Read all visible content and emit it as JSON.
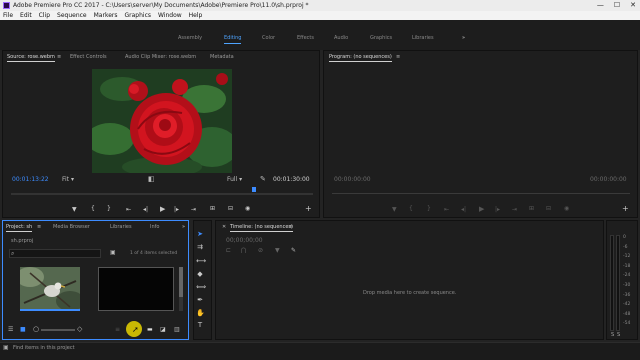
{
  "window": {
    "title": "Adobe Premiere Pro CC 2017 - C:\\Users\\server\\My Documents\\Adobe\\Premiere Pro\\11.0\\sh.prproj *",
    "minimize": "—",
    "maximize": "☐",
    "close": "✕"
  },
  "menu": [
    "File",
    "Edit",
    "Clip",
    "Sequence",
    "Markers",
    "Graphics",
    "Window",
    "Help"
  ],
  "workspaces": [
    "Assembly",
    "Editing",
    "Color",
    "Effects",
    "Audio",
    "Graphics",
    "Libraries"
  ],
  "workspace_more": "»",
  "source": {
    "tabs": [
      "Source: rose.webm",
      "Effect Controls",
      "Audio Clip Mixer: rose.webm",
      "Metadata"
    ],
    "timecode_in": "00:01:13:22",
    "fit": "Fit",
    "quality": "Full",
    "duration": "00:01:30:00",
    "playhead_fraction": 0.81
  },
  "program": {
    "tab": "Program: (no sequences)",
    "tc_left": "00:00:00:00",
    "tc_right": "00:00:00:00"
  },
  "project": {
    "tabs": [
      "Project: sh",
      "Media Browser",
      "Libraries",
      "Info"
    ],
    "file": "sh.prproj",
    "count": "1 of 4 items selected"
  },
  "timeline": {
    "tab": "Timeline: (no sequences)",
    "timecode": "00;00;00;00",
    "drop_hint": "Drop media here to create sequence."
  },
  "meter_labels": [
    "0",
    "-6",
    "-12",
    "-18",
    "-24",
    "-30",
    "-36",
    "-42",
    "-48",
    "-54"
  ],
  "status": "Find items in this project",
  "colors": {
    "accent": "#3d8cff",
    "cursor_highlight": "#e8d400"
  }
}
